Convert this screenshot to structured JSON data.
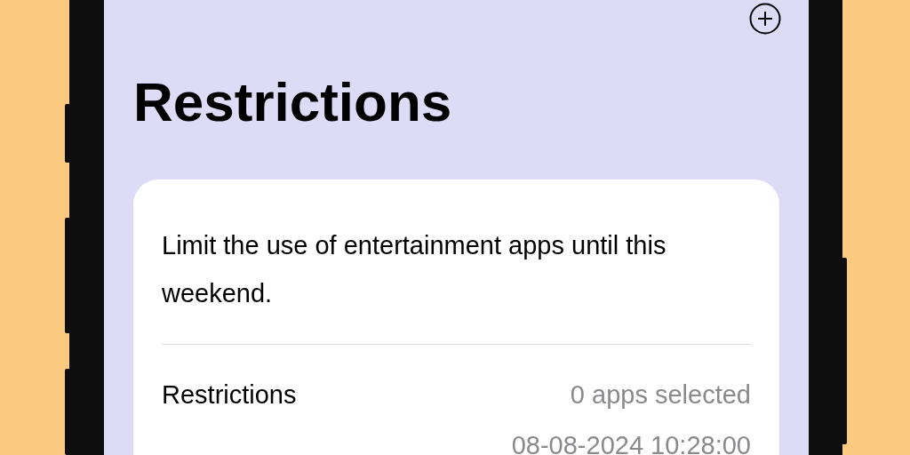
{
  "screen": {
    "title": "Restrictions"
  },
  "card": {
    "description": "Limit the use of entertainment apps until this weekend.",
    "rows": [
      {
        "label": "Restrictions",
        "value": "0 apps selected"
      },
      {
        "value": "08-08-2024 10:28:00"
      }
    ]
  }
}
